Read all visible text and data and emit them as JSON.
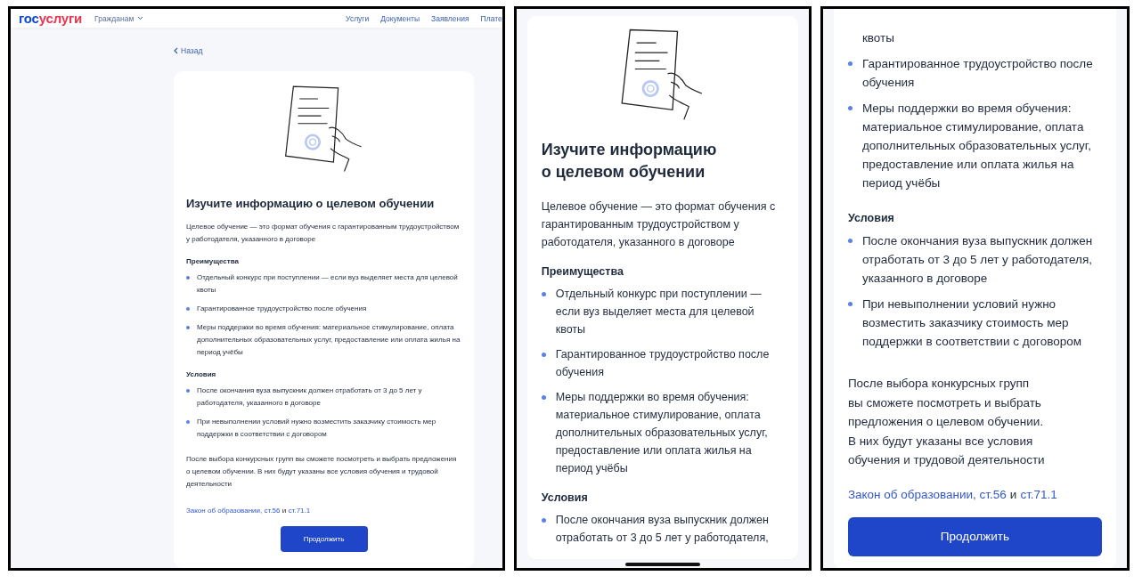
{
  "panels": [
    {
      "kind": "desktop",
      "header": {
        "logo": [
          "гос",
          "услуги"
        ],
        "audience": "Гражданам",
        "nav": [
          "Услуги",
          "Документы",
          "Заявления",
          "Плате"
        ]
      },
      "back": "Назад",
      "illustration": true,
      "title": "Изучите информацию о целевом обучении",
      "intro": "Целевое обучение — это формат обучения с гарантированным трудоустройством у работодателя, указанного в договоре",
      "sections": [
        {
          "heading": "Преимущества",
          "items": [
            {
              "kind": "item",
              "text": "Отдельный конкурс при поступлении — если вуз выделяет места для целевой квоты"
            },
            {
              "kind": "item",
              "text": "Гарантированное трудоустройство после обучения"
            },
            {
              "kind": "item",
              "text": "Меры поддержки во время обучения: материальное стимулирование, оплата дополнительных образовательных услуг, предоставление или оплата жилья на период учёбы"
            }
          ]
        },
        {
          "heading": "Условия",
          "items": [
            {
              "kind": "item",
              "text": "После окончания вуза выпускник должен отработать от 3 до 5 лет у работодателя, указанного в договоре"
            },
            {
              "kind": "item",
              "text": "При невыполнении условий нужно возместить заказчику стоимость мер поддержки в соответствии с договором"
            }
          ]
        }
      ],
      "note": "После выбора конкурсных групп вы сможете посмотреть и выбрать предложения о целевом обучении. В них будут указаны все условия обучения и трудовой деятельности",
      "law": [
        {
          "text": "Закон об образовании, ст.56",
          "link": true
        },
        {
          "text": "и",
          "link": false
        },
        {
          "text": "ст.71.1",
          "link": true
        }
      ],
      "button": "Продолжить"
    },
    {
      "kind": "mobile",
      "illustration": true,
      "title": "Изучите информацию о целевом обучении",
      "intro": "Целевое обучение — это формат обучения с гарантированным трудоустройством у работодателя, указанного в договоре",
      "sections": [
        {
          "heading": "Преимущества",
          "items": [
            {
              "kind": "item",
              "text": "Отдельный конкурс при поступлении — если вуз выделяет места для целевой квоты"
            },
            {
              "kind": "item",
              "text": "Гарантированное трудоустройство после обучения"
            },
            {
              "kind": "item",
              "text": "Меры поддержки во время обучения: материальное стимулирование, оплата дополнительных образовательных услуг, предоставление или оплата жилья на период учёбы"
            }
          ]
        },
        {
          "heading": "Условия",
          "items": [
            {
              "kind": "item",
              "text": "После окончания вуза выпускник должен отработать от 3 до 5 лет у работодателя,"
            }
          ]
        }
      ],
      "home_indicator": true
    },
    {
      "kind": "mobile",
      "sections": [
        {
          "items": [
            {
              "kind": "continuation",
              "text": "квоты"
            },
            {
              "kind": "item",
              "text": "Гарантированное трудоустройство после обучения"
            },
            {
              "kind": "item",
              "text": "Меры поддержки во время обучения: материальное стимулирование, оплата дополнительных образовательных услуг, предоставление или оплата жилья на период учёбы"
            }
          ]
        },
        {
          "heading": "Условия",
          "items": [
            {
              "kind": "item",
              "text": "После окончания вуза выпускник должен отработать от 3 до 5 лет у работодателя, указанного в договоре"
            },
            {
              "kind": "item",
              "text": "При невыполнении условий нужно возместить заказчику стоимость мер поддержки в соответствии с договором"
            }
          ]
        }
      ],
      "note": "После выбора конкурсных групп вы сможете посмотреть и выбрать предложения о целевом обучении. В них будут указаны все условия обучения и трудовой деятельности",
      "law": [
        {
          "text": "Закон об образовании, ст.56",
          "link": true
        },
        {
          "text": "и",
          "link": false
        },
        {
          "text": "ст.71.1",
          "link": true
        }
      ],
      "button": "Продолжить"
    }
  ]
}
